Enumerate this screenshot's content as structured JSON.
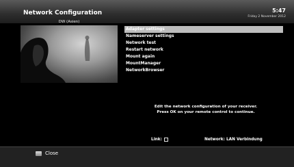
{
  "header": {
    "title": "Network Configuration",
    "time": "5:47",
    "date": "Friday 2 November 2012"
  },
  "preview": {
    "channel": "DW (Asien)"
  },
  "menu": {
    "items": [
      {
        "label": "Adapter settings",
        "selected": true
      },
      {
        "label": "Nameserver settings"
      },
      {
        "label": "Network test"
      },
      {
        "label": "Restart network"
      },
      {
        "label": "Mount again"
      },
      {
        "label": "MountManager"
      },
      {
        "label": "NetworkBrowser"
      }
    ]
  },
  "info": {
    "line1": "Edit the network configuration of your receiver.",
    "line2": "Press OK on your remote control to continue."
  },
  "status": {
    "link_label": "Link:",
    "network": "Network: LAN Verbindung"
  },
  "footer": {
    "close_label": "Close"
  },
  "colors": {
    "background": "#000000",
    "selection": "#bdbdbd",
    "footer": "#222222"
  }
}
